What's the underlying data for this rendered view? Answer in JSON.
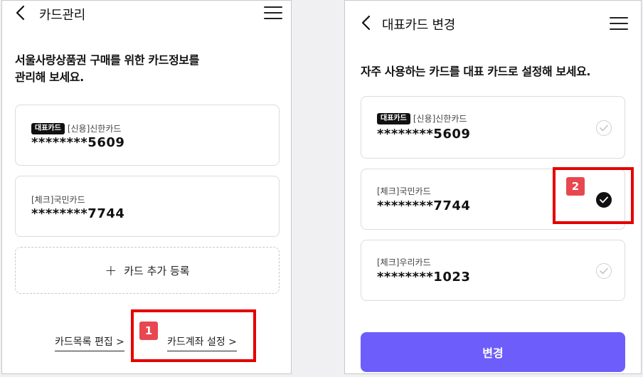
{
  "left_screen": {
    "title": "카드관리",
    "intro_line1": "서울사랑상품권 구매를 위한 카드정보를",
    "intro_line2": "관리해 보세요.",
    "cards": [
      {
        "badge": "대표카드",
        "name": "[신용]신한카드",
        "number": "********5609"
      },
      {
        "badge": "",
        "name": "[체크]국민카드",
        "number": "********7744"
      }
    ],
    "add_card_label": "카드 추가 등록",
    "edit_list_link": "카드목록 편집 >",
    "account_setting_link": "카드계좌 설정 >",
    "annotation_number": "1"
  },
  "right_screen": {
    "title": "대표카드 변경",
    "intro": "자주 사용하는 카드를 대표 카드로 설정해 보세요.",
    "cards": [
      {
        "badge": "대표카드",
        "name": "[신용]신한카드",
        "number": "********5609",
        "selected": false
      },
      {
        "badge": "",
        "name": "[체크]국민카드",
        "number": "********7744",
        "selected": true
      },
      {
        "badge": "",
        "name": "[체크]우리카드",
        "number": "********1023",
        "selected": false
      }
    ],
    "change_button_label": "변경",
    "annotation_number": "2"
  },
  "colors": {
    "accent_button": "#6d5efb",
    "annotation_red": "#e60000",
    "annotation_tag": "#e9474f"
  }
}
